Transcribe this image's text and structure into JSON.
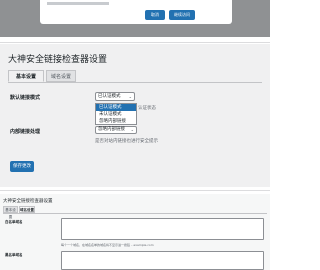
{
  "dialog": {
    "cancel_label": "取消",
    "confirm_label": "继续访问"
  },
  "settings": {
    "title": "大神安全链接检查器设置",
    "tabs": [
      "基本设置",
      "域名设置"
    ],
    "default_link_mode": {
      "label": "默认链接模式",
      "selected": "已认证模式",
      "options": [
        "已认证模式",
        "未认证模式",
        "忽略内部链接"
      ],
      "hint": "认证状态"
    },
    "internal_links": {
      "label": "内部链接处理",
      "selected": "忽略内部链接",
      "description": "是否对站内链接也进行安全提示"
    },
    "save_label": "保存更改"
  },
  "domain_settings": {
    "title": "大神安全链接检查器设置",
    "tabs": [
      "基本设置",
      "域名设置"
    ],
    "whitelist_label": "白名单域名",
    "whitelist_hint": "每个一个域名，在域名名单的域名将不显示进一搜链 – example.com",
    "blacklist_label": "黑名单域名"
  }
}
